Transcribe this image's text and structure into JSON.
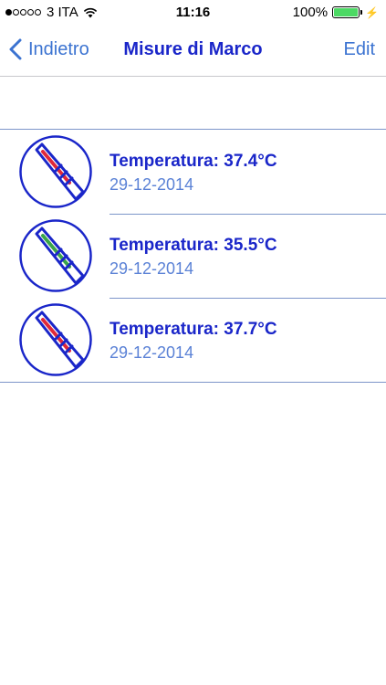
{
  "status_bar": {
    "carrier": "3 ITA",
    "time": "11:16",
    "battery": "100%",
    "battery_color": "#4cd964"
  },
  "nav": {
    "back_label": "Indietro",
    "title": "Misure di Marco",
    "edit_label": "Edit"
  },
  "measurements": [
    {
      "title": "Temperatura: 37.4°C",
      "date": "29-12-2014",
      "indicator_color": "#e0283a"
    },
    {
      "title": "Temperatura: 35.5°C",
      "date": "29-12-2014",
      "indicator_color": "#3aa54a"
    },
    {
      "title": "Temperatura: 37.7°C",
      "date": "29-12-2014",
      "indicator_color": "#e0283a"
    }
  ],
  "colors": {
    "accent": "#3b73d1",
    "title": "#1a26c9",
    "date": "#5b82d6",
    "icon_stroke": "#1a26c9"
  }
}
